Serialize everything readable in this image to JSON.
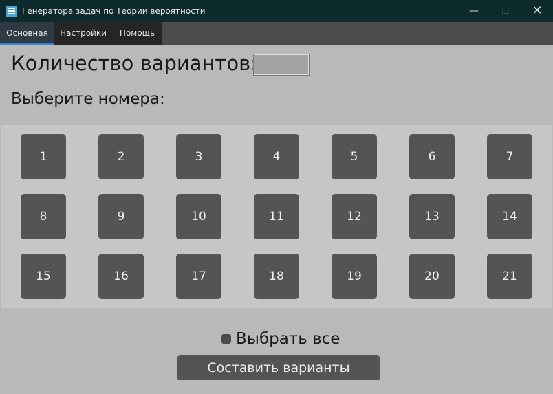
{
  "window": {
    "title": "Генератора задач по Теории вероятности",
    "controls": {
      "minimize": "—",
      "maximize": "☐",
      "close": "✕"
    }
  },
  "menu": {
    "tabs": [
      {
        "label": "Основная",
        "active": true
      },
      {
        "label": "Настройки",
        "active": false
      },
      {
        "label": "Помощь",
        "active": false
      }
    ]
  },
  "main": {
    "variants_label": "Количество вариантов:",
    "variants_value": "",
    "choose_label": "Выберите номера:",
    "numbers": [
      "1",
      "2",
      "3",
      "4",
      "5",
      "6",
      "7",
      "8",
      "9",
      "10",
      "11",
      "12",
      "13",
      "14",
      "15",
      "16",
      "17",
      "18",
      "19",
      "20",
      "21"
    ],
    "select_all_label": "Выбрать все",
    "select_all_checked": false,
    "submit_label": "Составить варианты"
  },
  "colors": {
    "titlebar": "#0d2a2d",
    "menubar": "#4c4c4c",
    "active_tab_underline": "#2f86d8",
    "panel": "#b9b9b9",
    "grid_panel": "#c6c6c6",
    "button": "#545454"
  }
}
